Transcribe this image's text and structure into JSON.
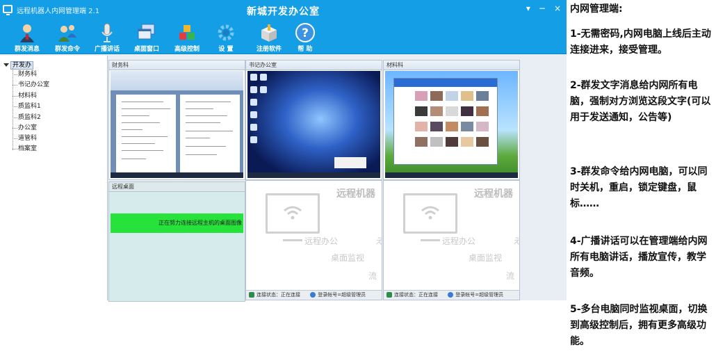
{
  "window": {
    "app_title": "远程机器人内网管理端 2.1",
    "center_title": "新城开发办公室",
    "controls": [
      "▾",
      "−",
      "×"
    ]
  },
  "toolbar": [
    {
      "label": "群发消息",
      "icon": "person-icon"
    },
    {
      "label": "群发命令",
      "icon": "people-icon"
    },
    {
      "label": "广播讲话",
      "icon": "microphone-icon"
    },
    {
      "label": "桌面窗口",
      "icon": "windows-icon"
    },
    {
      "label": "高级控制",
      "icon": "cubes-icon"
    },
    {
      "label": "设 置",
      "icon": "gear-icon"
    },
    {
      "label": "注册软件",
      "icon": "box-icon"
    },
    {
      "label": "帮 助",
      "icon": "help-icon"
    }
  ],
  "tree": {
    "root": "开发办",
    "items": [
      "财务科",
      "书记办公室",
      "材料科",
      "质监科1",
      "质监科2",
      "办公室",
      "道管科",
      "档案室"
    ]
  },
  "tiles": {
    "t1": {
      "caption": "财务科"
    },
    "t2": {
      "caption": "书记办公室"
    },
    "t3": {
      "caption": "材料科"
    },
    "t4": {
      "caption": "远程桌面",
      "message": "正在努力连接远程主机的桌面图像"
    },
    "placeholder": {
      "watermark_title": "远程机器",
      "line1": "远程办公",
      "line1_suffix": "え",
      "line2": "桌面监视",
      "line3": "流",
      "status_connect": "连接状态：正在连接",
      "status_account": "登录帐号=超级管理员"
    }
  },
  "description": {
    "heading": "内网管理端:",
    "points": [
      "1-无需密码,内网电脑上线后主动连接进来，接受管理。",
      "2-群发文字消息给内网所有电脑，强制对方浏览这段文字(可以用于发送通知，公告等)",
      "3-群发命令给内网电脑，可以同时关机，重启，锁定键盘，鼠标……",
      "4-广播讲话可以在管理端给内网所有电脑讲话，播放宣传，教学音频。",
      "5-多台电脑同时监视桌面，切换到高级控制后，拥有更多高级功能。"
    ]
  },
  "colors": {
    "titlebar": "#149ee6",
    "connecting": "#27e23a"
  }
}
